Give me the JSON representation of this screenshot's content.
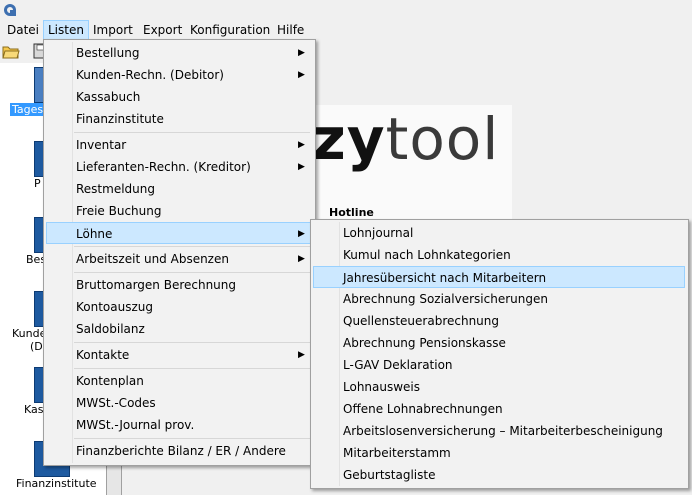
{
  "menubar": {
    "items": [
      "Datei",
      "Listen",
      "Import",
      "Export",
      "Konfiguration",
      "Hilfe"
    ]
  },
  "toolbar": {
    "icons": [
      "open-folder-icon",
      "save-icon"
    ]
  },
  "left_panel": {
    "items": [
      {
        "label": "Tages",
        "icon": "daily-icon"
      },
      {
        "label": "P",
        "icon": "doc-icon"
      },
      {
        "label": "Bes",
        "icon": "order-icon"
      },
      {
        "label": "Kunde",
        "icon": "customer-icon"
      },
      {
        "label": "(D",
        "icon": ""
      },
      {
        "label": "Kas",
        "icon": "cashbook-icon"
      },
      {
        "label": "Finanzinstitute",
        "icon": "bank-icon"
      }
    ]
  },
  "logo": {
    "bold": "zy",
    "light": "tool"
  },
  "hotline": "Hotline",
  "listen_menu": {
    "items": [
      {
        "label": "Bestellung",
        "submenu": true
      },
      {
        "label": "Kunden-Rechn. (Debitor)",
        "submenu": true
      },
      {
        "label": "Kassabuch",
        "submenu": false
      },
      {
        "label": "Finanzinstitute",
        "submenu": false
      },
      {
        "label": "Inventar",
        "submenu": true
      },
      {
        "label": "Lieferanten-Rechn. (Kreditor)",
        "submenu": true
      },
      {
        "label": "Restmeldung",
        "submenu": false
      },
      {
        "label": "Freie Buchung",
        "submenu": false
      },
      {
        "label": "Löhne",
        "submenu": true
      },
      {
        "label": "Arbeitszeit und Absenzen",
        "submenu": true
      },
      {
        "label": "Bruttomargen Berechnung",
        "submenu": false
      },
      {
        "label": "Kontoauszug",
        "submenu": false
      },
      {
        "label": "Saldobilanz",
        "submenu": false
      },
      {
        "label": "Kontakte",
        "submenu": true
      },
      {
        "label": "Kontenplan",
        "submenu": false
      },
      {
        "label": "MWSt.-Codes",
        "submenu": false
      },
      {
        "label": "MWSt.-Journal prov.",
        "submenu": false
      },
      {
        "label": "Finanzberichte Bilanz / ER / Andere",
        "submenu": false
      }
    ],
    "highlighted": "Löhne"
  },
  "loehne_submenu": {
    "items": [
      "Lohnjournal",
      "Kumul nach Lohnkategorien",
      "Jahresübersicht nach Mitarbeitern",
      "Abrechnung Sozialversicherungen",
      "Quellensteuerabrechnung",
      "Abrechnung Pensionskasse",
      "L-GAV Deklaration",
      "Lohnausweis",
      "Offene Lohnabrechnungen",
      "Arbeitslosenversicherung – Mitarbeiterbescheinigung",
      "Mitarbeiterstamm",
      "Geburtstagliste"
    ],
    "highlighted": "Jahresübersicht nach Mitarbeitern"
  },
  "colors": {
    "highlight_bg": "#cce8ff",
    "highlight_border": "#99d1ff",
    "menu_bg": "#f2f2f2",
    "icon_blue": "#1e5aa0",
    "selection_blue": "#3399ff"
  }
}
